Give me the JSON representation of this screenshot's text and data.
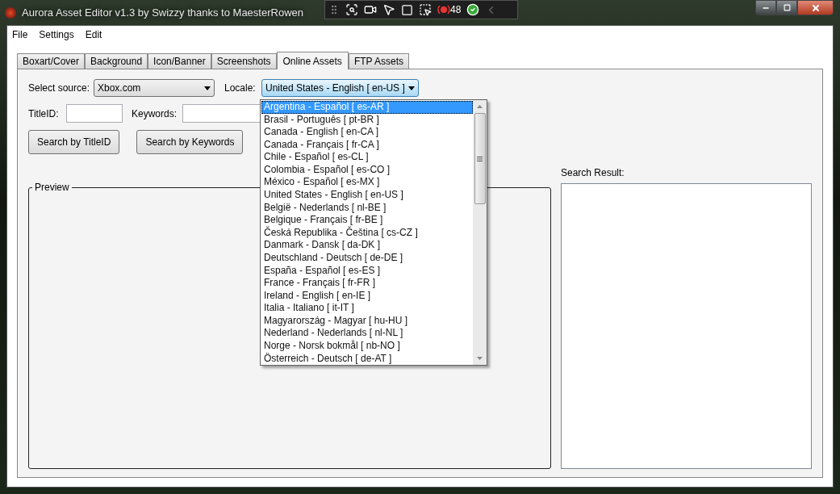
{
  "window": {
    "title": "Aurora Asset Editor v1.3 by Swizzy thanks to MaesterRowen"
  },
  "overlay_toolbar": {
    "counter": "48"
  },
  "menu": [
    "File",
    "Settings",
    "Edit"
  ],
  "tabs": [
    {
      "label": "Boxart/Cover",
      "selected": false
    },
    {
      "label": "Background",
      "selected": false
    },
    {
      "label": "Icon/Banner",
      "selected": false
    },
    {
      "label": "Screenshots",
      "selected": false
    },
    {
      "label": "Online Assets",
      "selected": true
    },
    {
      "label": "FTP Assets",
      "selected": false
    }
  ],
  "source": {
    "label": "Select source:",
    "value": "Xbox.com"
  },
  "locale": {
    "label": "Locale:",
    "value": "United States - English [ en-US ]",
    "expanded": true
  },
  "title_id": {
    "label": "TitleID:"
  },
  "keywords": {
    "label": "Keywords:"
  },
  "buttons": [
    "Search by TitleID",
    "Search by Keywords"
  ],
  "preview": {
    "label": "Preview"
  },
  "search_result": {
    "label": "Search Result:"
  },
  "locale_options": [
    {
      "label": "Argentina - Español [ es-AR ]",
      "selected": true
    },
    {
      "label": "Brasil - Português [ pt-BR ]",
      "selected": false
    },
    {
      "label": "Canada - English [ en-CA ]",
      "selected": false
    },
    {
      "label": "Canada - Français [ fr-CA ]",
      "selected": false
    },
    {
      "label": "Chile - Español [ es-CL ]",
      "selected": false
    },
    {
      "label": "Colombia - Español [ es-CO ]",
      "selected": false
    },
    {
      "label": "México - Español [ es-MX ]",
      "selected": false
    },
    {
      "label": "United States - English [ en-US ]",
      "selected": false
    },
    {
      "label": "België - Nederlands [ nl-BE ]",
      "selected": false
    },
    {
      "label": "Belgique - Français [ fr-BE ]",
      "selected": false
    },
    {
      "label": "Česká Republika - Čeština [ cs-CZ ]",
      "selected": false
    },
    {
      "label": "Danmark - Dansk [ da-DK ]",
      "selected": false
    },
    {
      "label": "Deutschland - Deutsch [ de-DE ]",
      "selected": false
    },
    {
      "label": "España - Español [ es-ES ]",
      "selected": false
    },
    {
      "label": "France - Français [ fr-FR ]",
      "selected": false
    },
    {
      "label": "Ireland - English [ en-IE ]",
      "selected": false
    },
    {
      "label": "Italia - Italiano [ it-IT ]",
      "selected": false
    },
    {
      "label": "Magyarország - Magyar [ hu-HU ]",
      "selected": false
    },
    {
      "label": "Nederland - Nederlands [ nl-NL ]",
      "selected": false
    },
    {
      "label": "Norge - Norsk bokmål [ nb-NO ]",
      "selected": false
    },
    {
      "label": "Österreich - Deutsch [ de-AT ]",
      "selected": false
    }
  ]
}
